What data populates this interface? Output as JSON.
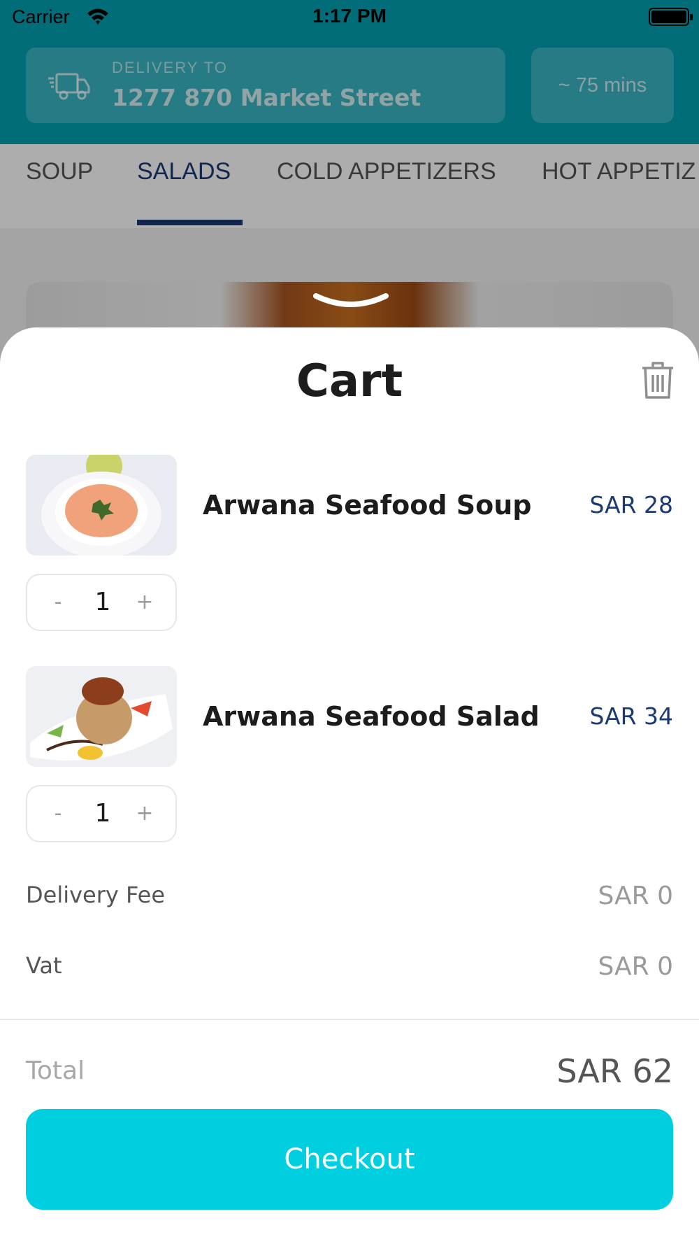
{
  "status_bar": {
    "carrier": "Carrier",
    "time": "1:17 PM"
  },
  "header": {
    "delivery_label": "DELIVERY TO",
    "delivery_address": "1277 870 Market Street",
    "eta": "~ 75 mins",
    "background_color": "#00a1b2"
  },
  "tabs": [
    {
      "label": "SOUP",
      "active": false
    },
    {
      "label": "SALADS",
      "active": true
    },
    {
      "label": "COLD APPETIZERS",
      "active": false
    },
    {
      "label": "HOT APPETIZ",
      "active": false
    }
  ],
  "cart": {
    "title": "Cart",
    "items": [
      {
        "name": "Arwana Seafood Soup",
        "price": "SAR 28",
        "quantity": "1",
        "minus": "-",
        "plus": "+"
      },
      {
        "name": "Arwana Seafood Salad",
        "price": "SAR 34",
        "quantity": "1",
        "minus": "-",
        "plus": "+"
      }
    ],
    "fees": [
      {
        "label": "Delivery Fee",
        "value": "SAR 0"
      },
      {
        "label": "Vat",
        "value": "SAR 0"
      }
    ],
    "total_label": "Total",
    "total_value": "SAR 62",
    "checkout_label": "Checkout"
  },
  "colors": {
    "accent": "#00cfe0",
    "price": "#1a3a72",
    "active_tab": "#1a3a72"
  },
  "icons": [
    "wifi-icon",
    "battery-icon",
    "truck-icon",
    "trash-icon",
    "chevron-down-icon"
  ]
}
